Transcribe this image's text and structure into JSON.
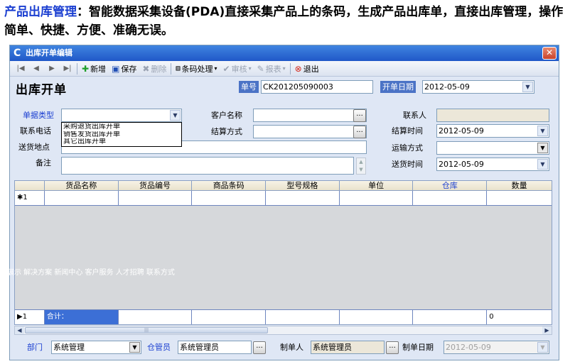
{
  "caption": {
    "highlight": "产品出库管理",
    "text": "：智能数据采集设备(PDA)直接采集产品上的条码，生成产品出库单，直接出库管理，操作简单、快捷、方便、准确无误。"
  },
  "window": {
    "title": "出库开单编辑",
    "close_symbol": "✕"
  },
  "toolbar": {
    "nav_first": "|◀",
    "nav_prev": "◀",
    "nav_next": "▶",
    "nav_last": "▶|",
    "add": "新增",
    "save": "保存",
    "delete": "删除",
    "barcode": "条码处理",
    "review": "审核",
    "report": "报表",
    "exit": "退出"
  },
  "form": {
    "title": "出库开单",
    "order_no_label": "单号",
    "order_no": "CK201205090003",
    "order_date_label": "开单日期",
    "order_date": "2012-05-09",
    "doc_type_label": "单据类型",
    "doc_type_value": "",
    "doc_type_options": [
      "采购退货出库开单",
      "销售发货出库开单",
      "其它出库开单"
    ],
    "contact_phone_label": "联系电话",
    "customer_label": "客户名称",
    "customer_value": "",
    "contact_label": "联系人",
    "contact_value": "",
    "settle_method_label": "结算方式",
    "settle_method_value": "",
    "settle_time_label": "结算时间",
    "settle_time": "2012-05-09",
    "delivery_place_label": "送货地点",
    "delivery_place_value": "",
    "transport_label": "运输方式",
    "transport_value": "",
    "remark_label": "备注",
    "remark_value": "",
    "delivery_time_label": "送货时间",
    "delivery_time": "2012-05-09"
  },
  "grid": {
    "columns": [
      "",
      "货品名称",
      "货品编号",
      "商品条码",
      "型号规格",
      "单位",
      "仓库",
      "数量"
    ],
    "row1": [
      "✱1",
      "",
      "",
      "",
      "",
      "",
      "",
      ""
    ],
    "total_row": [
      "▶1",
      "合计：",
      "",
      "",
      "",
      "",
      "",
      "0"
    ]
  },
  "overlay_text": "品展示 解决方案 新闻中心 客户服务 人才招聘 联系方式",
  "footer": {
    "dept_label": "部门",
    "dept_value": "系统管理",
    "keeper_label": "仓管员",
    "keeper_value": "系统管理员",
    "creator_label": "制单人",
    "creator_value": "系统管理员",
    "create_date_label": "制单日期",
    "create_date": "2012-05-09"
  },
  "colors": {
    "caption_highlight": "#1b3fd1",
    "titlebar": "#2058c8",
    "label_blue": "#4b73c6",
    "selected_cell": "#3c6fd6"
  }
}
